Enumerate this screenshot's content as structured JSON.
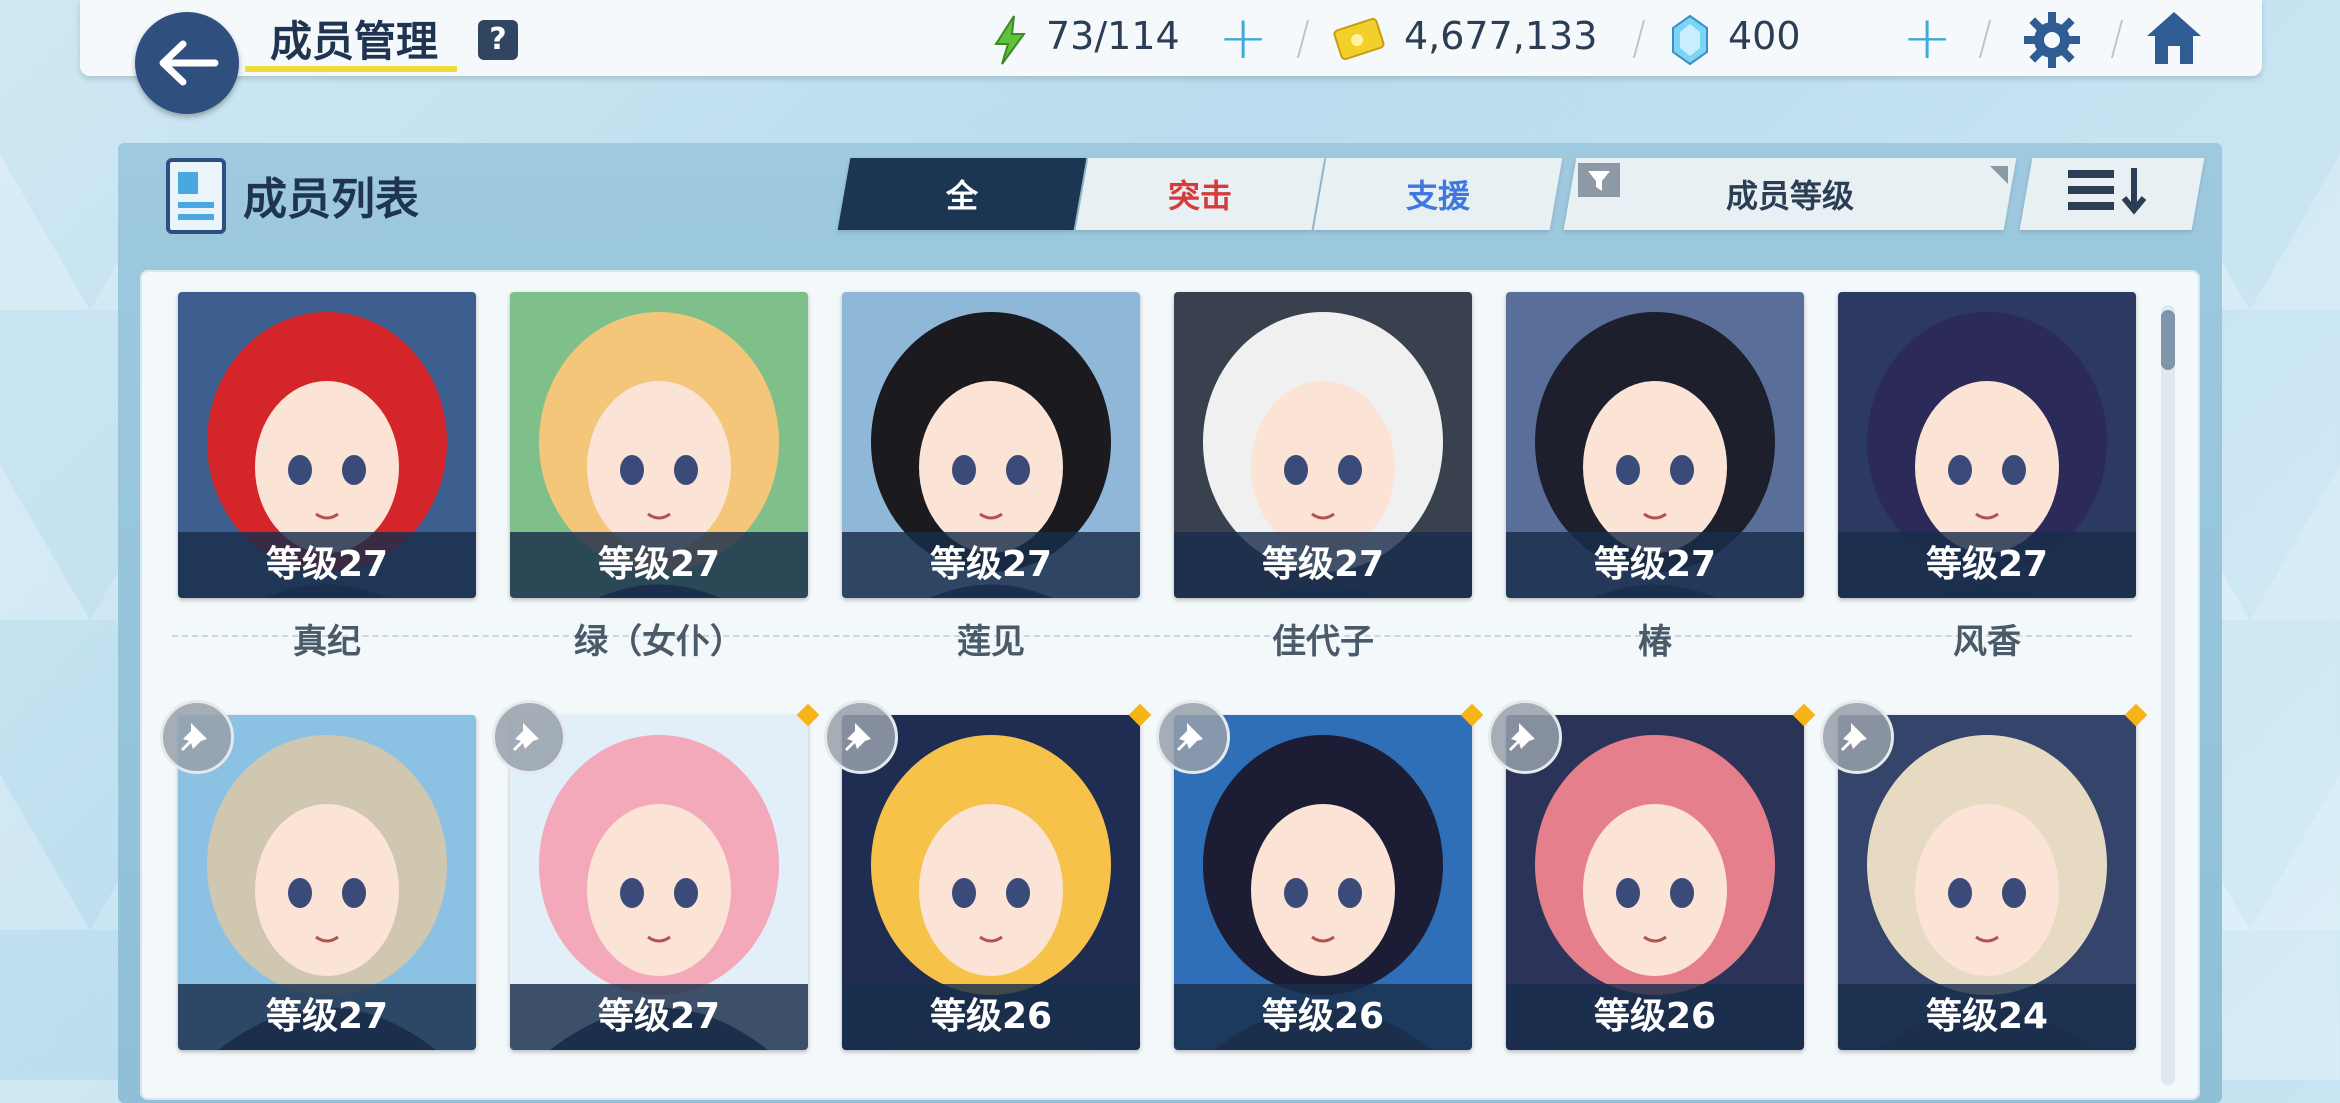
{
  "header": {
    "title": "成员管理",
    "help": "?",
    "ap": "73/114",
    "credits": "4,677,133",
    "gems": "400",
    "plus": "+"
  },
  "panel": {
    "title": "成员列表",
    "tabs": [
      {
        "label": "全",
        "color": "#ffffff",
        "bg": "#1c3552"
      },
      {
        "label": "突击",
        "color": "#d63b3b",
        "bg": "#e9f0f4"
      },
      {
        "label": "支援",
        "color": "#3f79e0",
        "bg": "#e9f0f4"
      }
    ],
    "sort_label": "成员等级"
  },
  "rows": [
    [
      {
        "level": "等级27",
        "name": "真纪",
        "hair": "#d4262a",
        "bg": "#3c5f8f"
      },
      {
        "level": "等级27",
        "name": "绿（女仆）",
        "hair": "#f3c67a",
        "bg": "#7fbf8a"
      },
      {
        "level": "等级27",
        "name": "莲见",
        "hair": "#1b1a1e",
        "bg": "#8fb7d8"
      },
      {
        "level": "等级27",
        "name": "佳代子",
        "hair": "#f0f0f0",
        "bg": "#39414e"
      },
      {
        "level": "等级27",
        "name": "椿",
        "hair": "#1d1f2c",
        "bg": "#5a6e9a"
      },
      {
        "level": "等级27",
        "name": "风香",
        "hair": "#2b2a58",
        "bg": "#2c3a62"
      }
    ],
    [
      {
        "level": "等级27",
        "hair": "#cfc7b0",
        "bg": "#8bc1e3"
      },
      {
        "level": "等级27",
        "hair": "#f3a9b9",
        "bg": "#e2eef8"
      },
      {
        "level": "等级26",
        "hair": "#f7c24a",
        "bg": "#1f2d52"
      },
      {
        "level": "等级26",
        "hair": "#1c1d35",
        "bg": "#2f6fb8"
      },
      {
        "level": "等级26",
        "hair": "#e57f8c",
        "bg": "#2b3358"
      },
      {
        "level": "等级24",
        "hair": "#e6dbc2",
        "bg": "#35446b"
      }
    ]
  ]
}
